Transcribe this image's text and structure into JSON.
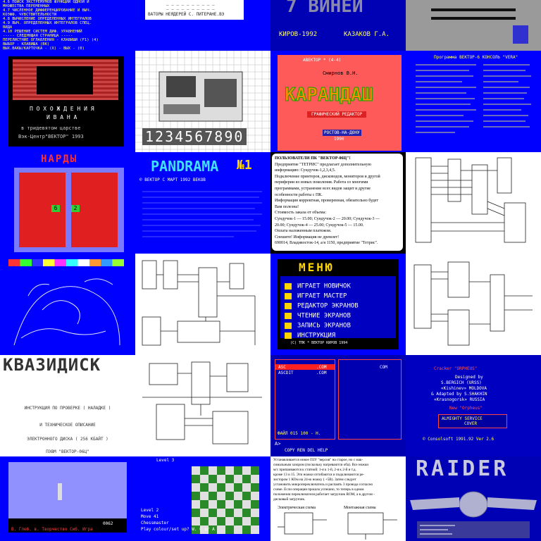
{
  "tiles": {
    "r1c1": {
      "lines": [
        "4.6 ПОИСК ЭКСТРЕМУМОВ ФУНКЦИИ ОДНОЙ И",
        "   МНОЖЕСТВА ПЕРЕМЕННЫХ",
        "4.7 ЧИСЛЕННОЕ ДИФФЕРЕНЦИРОВАНИЕ И ВЫЧ.",
        "   КОЭФФ. ЧУВСТВИТЕЛЬНОСТИ",
        "4.8 ВЫЧИСЛЕНИЕ ОПРЕДЕЛЕННЫХ ИНТЕГРАЛОВ",
        "4.9 ВЫЧ. ОПРЕДЕЛЕННЫХ ИНТЕГРАЛОВ СПЕЦ.",
        "   ВИДА",
        "4.10 РЕШЕНИЕ СИСТЕМ ДИФ. УРАВНЕНИЙ",
        "----- СЛЕДУЮЩАЯ СТРАНИЦА -----",
        "ПЕРЕЛИСТНИЕ ОГЛАВЛЕНИЯ - КЛАВИШИ (F1) (4)",
        "ВЫБОР - КЛАВИША (ВК)",
        "ВЫХ.ВАКЫ/КАРТОЧКА - (Х) - ВЫХ - (0)"
      ]
    },
    "r1c2": {
      "line1": "ВАТОРЫ НЕЯДЕРЕЙ  С. ПИТЕРАНЕ.ВЭ"
    },
    "r1c3": {
      "title": "7 ВИНЕЙ",
      "city": "КИРОВ-1992",
      "author": "КАЗАКОВ Г.А."
    },
    "r2c1": {
      "line1": "П О Х О Ж Д Е Н И Я",
      "line2": "И В А Н А",
      "line3": "в тридевятом   царстве",
      "line4": "Вэк-Центр\"ВЕКТОР\"  1993"
    },
    "r2c2": {
      "digits": "1234567890"
    },
    "r2c3": {
      "top": "АВЕКТОР  * (4-4)",
      "author": "Смирнов В.Н.",
      "title": "КАРАНДАШ",
      "subtitle": "ГРАФИЧЕСКИЙ РЕДАКТОР",
      "place": "РОСТОВ-НА-ДОНУ",
      "year": "1990"
    },
    "r2c4": {
      "header": "Программа ВЕКТОР-6 КОНСОЛЬ \"VERA\""
    },
    "r3c1": {
      "title": "НАРДЫ",
      "s1": "6",
      "s2": "2"
    },
    "r3c2": {
      "title": "PANDRAMA",
      "num": "№1",
      "line1": "© ВЕКТОР  С      МАРТ 1992  ВЕКОВ"
    },
    "r3c3": {
      "lines": [
        "ПОЛЬЗОВАТЕЛИ ПК \"ВЕКТОР-06Ц\"!",
        "Предприятие \"ТЕТРИС\" предлагает дополнительную",
        "информацию: Сундучок-1,2,3,4,5.",
        "Подключение принтеров, дисководов, мониторов и другой",
        "периферии из новых поколения. Работа со многими",
        "программами, устранение всех видов защит и другие",
        "особенности работы с ПК.",
        "Информация корректная, проверенная, обязательно будет",
        "Вам полезна!",
        "Стоимость заказа от объема:",
        "Сундучок-1 — 15.00; Сундучок-2 — 20.00; Сундучок-3 —",
        "20.00; Сундучок-4 — 25.00; Сундучок-5 — 15.00.",
        "Оплата наложенным платежом.",
        "Спешите! Информация не дремлет!",
        "690014, Владивосток-14, а/я 1150, предприятие \"Тетрис\"."
      ]
    },
    "r4c3": {
      "title": "МЕНЮ",
      "items": [
        "ИГРАЕТ НОВИЧОК",
        "ИГРАЕТ МАСТЕР",
        "РЕДАКТОР ЭКРАНОВ",
        "ЧТЕНИЕ ЭКРАНОВ",
        "ЗАПИСЬ ЭКРАНОВ",
        "ИНСТРУКЦИЯ"
      ],
      "footer": "(С) ТПК   * ВЕКТОР  КИРОВ 1994"
    },
    "r5c1": {
      "title": "КВАЗИДИСК",
      "lines": [
        "ИНСТРУКЦИЯ ПО ПРОВЕРКЕ ( НАЛАДКЕ )",
        "И ТЕХНИЧЕСКОЕ ОПИСАНИЕ",
        "ЭЛЕКТРОННОГО ДИСКА ( 256 КБАЙТ )",
        "ПЭВМ \"ВЕКТОР-06Ц\""
      ]
    },
    "r5c3": {
      "left_file1": "ASC",
      "left_ext1": ".COM",
      "left_file2": "ASCDIT",
      "left_ext2": ".COM",
      "right_hdr": "СОМ",
      "bottom1": "ФАЙЛ  015  100 - Н.",
      "bottom2": "A>",
      "fkeys": "COPY REN   DEL   HELP"
    },
    "r5c4": {
      "line1": "Cracker    \"ORPHEUS\"",
      "line2": "Designed by",
      "line3": "S.BERGICH (URSS)",
      "line4": "«Kishinev» MOLDOVA",
      "line5": "& Adapted by S.SHAKHIN",
      "line6": "«Krasnogorsk» RUSSIA",
      "line7": "New \"Orpheus\"",
      "box1": "ALMIGHTY SERVICE",
      "box2": "COVER",
      "footer": "© Consolsoft 1991.92 Ver 2.6"
    },
    "r6c1": {
      "score": "0062",
      "footer": "В. Глеб. в. Творчество Сиб. Игра"
    },
    "r6c2": {
      "top": "Level    3",
      "lines": [
        "Level 2",
        "Move 41",
        "Chessmaster",
        "Play colour/set up? W. C or A"
      ]
    },
    "r6c3": {
      "lines": [
        "Устанавливается новое ПЗУ \"версия\" на старое, но с мак-",
        "симальным зазором (поскольку нагреваются оба). Все ножки",
        "м/с припаиваются к статной: 1-я к 1-й, 2-я к 2-й и т.д.",
        "кроме 13 и 15. Эти ножки отгибаются и подключаются ре-",
        "зистором 1 КОм на 24-ю ножку ( +5В). Затем следует",
        "установить микропереключатель и распаять 3 провода согласно",
        "схеме. Если операция прошла успешно, то теперь в одном",
        "положении переключателя работает загрузчик ROM, а в другом -",
        "дисковый загрузчик."
      ],
      "cap1": "Электрическая схема",
      "cap2": "Монтажная схема"
    },
    "r6c4": {
      "title": "RAIDER"
    }
  }
}
